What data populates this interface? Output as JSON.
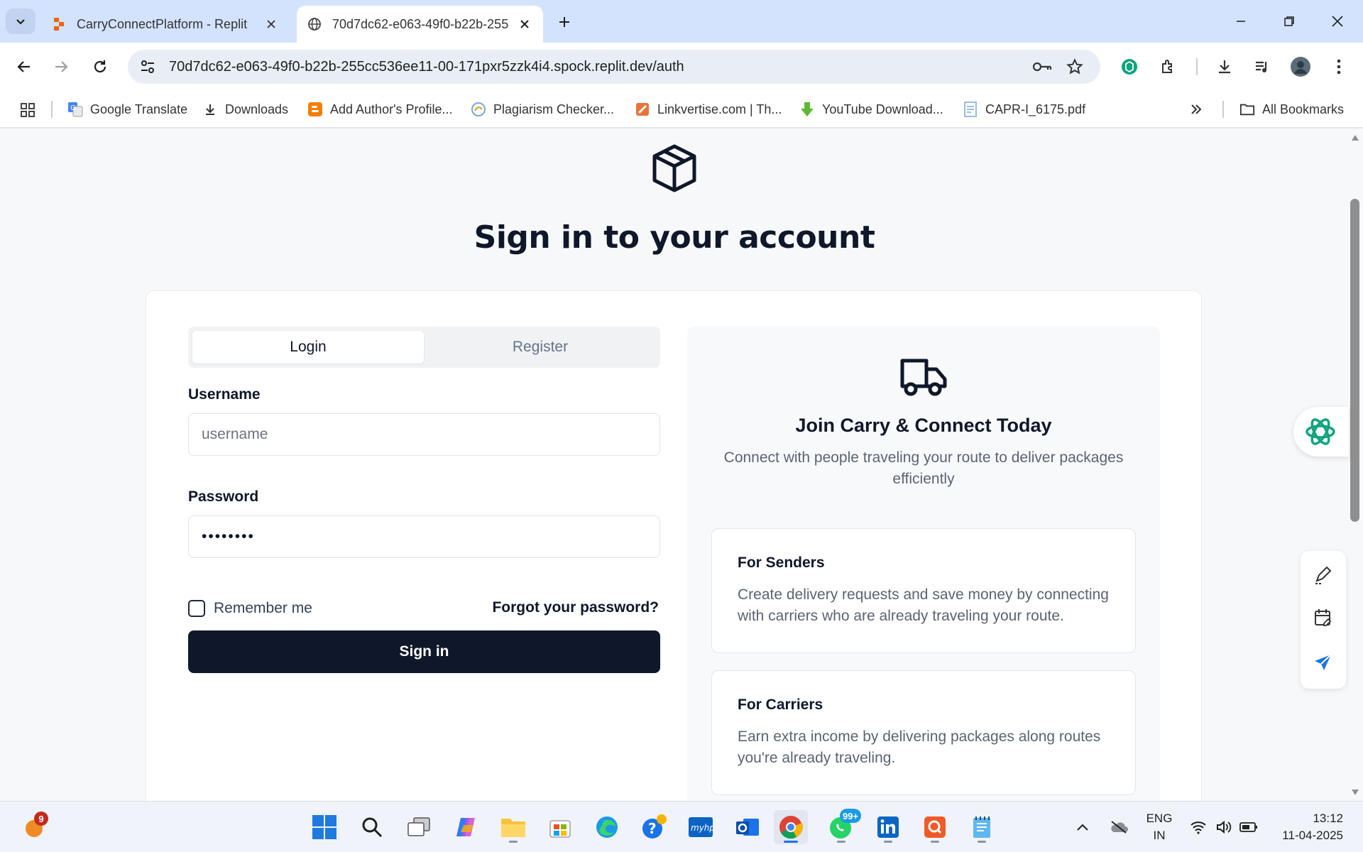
{
  "browser": {
    "tabs": [
      {
        "title": "CarryConnectPlatform - Replit",
        "favicon": "replit-icon"
      },
      {
        "title": "70d7dc62-e063-49f0-b22b-255",
        "favicon": "globe-icon"
      }
    ],
    "url": "70d7dc62-e063-49f0-b22b-255cc536ee11-00-171pxr5zzk4i4.spock.replit.dev/auth",
    "bookmarks": [
      {
        "label": "Google Translate",
        "icon": "google-translate-icon"
      },
      {
        "label": "Downloads",
        "icon": "download-icon"
      },
      {
        "label": "Add Author's Profile...",
        "icon": "blogger-icon"
      },
      {
        "label": "Plagiarism Checker...",
        "icon": "plagiarism-icon"
      },
      {
        "label": "Linkvertise.com | Th...",
        "icon": "linkvertise-icon"
      },
      {
        "label": "YouTube Download...",
        "icon": "green-download-icon"
      },
      {
        "label": "CAPR-I_6175.pdf",
        "icon": "pdf-icon"
      }
    ],
    "all_bookmarks": "All Bookmarks"
  },
  "page": {
    "title": "Sign in to your account",
    "tabs": {
      "login": "Login",
      "register": "Register"
    },
    "username": {
      "label": "Username",
      "placeholder": "username"
    },
    "password": {
      "label": "Password",
      "value": "••••••••"
    },
    "remember": "Remember me",
    "forgot": "Forgot your password?",
    "signin": "Sign in",
    "promo": {
      "title": "Join Carry & Connect Today",
      "subtitle": "Connect with people traveling your route to deliver packages efficiently",
      "features": [
        {
          "title": "For Senders",
          "text": "Create delivery requests and save money by connecting with carriers who are already traveling your route."
        },
        {
          "title": "For Carriers",
          "text": "Earn extra income by delivering packages along routes you're already traveling."
        }
      ]
    }
  },
  "taskbar": {
    "notification_badge": "9",
    "whatsapp_badge": "99+",
    "language": {
      "line1": "ENG",
      "line2": "IN"
    },
    "time": "13:12",
    "date": "11-04-2025"
  },
  "colors": {
    "primary": "#0f172a",
    "accent_blue": "#1a73e8",
    "page_bg": "#f7f8fa"
  }
}
